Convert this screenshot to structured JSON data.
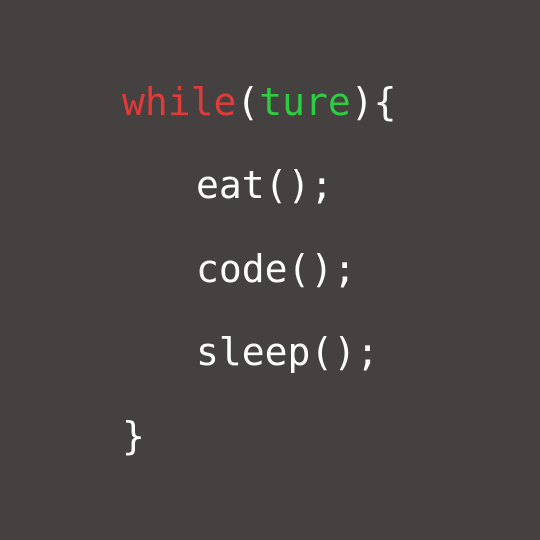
{
  "code": {
    "keyword": "while",
    "open_paren": "(",
    "condition": "ture",
    "close_paren_brace": "){",
    "body": [
      {
        "statement": "eat();"
      },
      {
        "statement": "code();"
      },
      {
        "statement": "sleep();"
      }
    ],
    "closing_brace": "}"
  },
  "colors": {
    "background": "#454140",
    "keyword": "#e03b3b",
    "condition": "#2ecc40",
    "text": "#ffffff"
  }
}
